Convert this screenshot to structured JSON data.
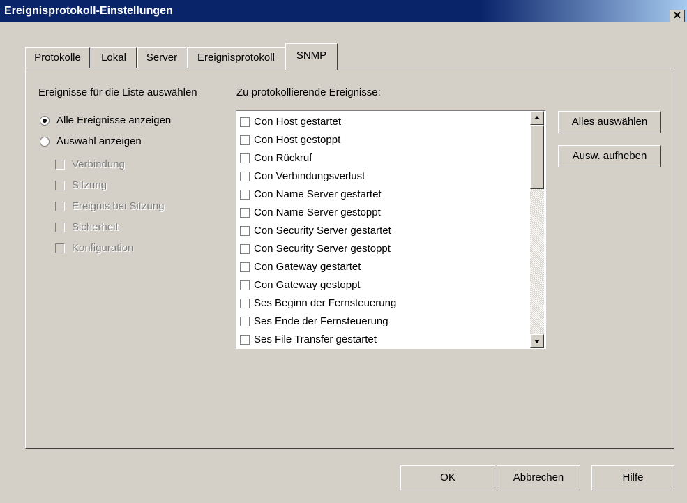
{
  "window": {
    "title": "Ereignisprotokoll-Einstellungen",
    "close_glyph": "✕"
  },
  "tabs": [
    "Protokolle",
    "Lokal",
    "Server",
    "Ereignisprotokoll",
    "SNMP"
  ],
  "left": {
    "heading": "Ereignisse für die Liste auswählen",
    "radio_all": "Alle Ereignisse anzeigen",
    "radio_selection": "Auswahl anzeigen",
    "categories": [
      "Verbindung",
      "Sitzung",
      "Ereignis bei Sitzung",
      "Sicherheit",
      "Konfiguration"
    ]
  },
  "events": {
    "heading": "Zu protokollierende Ereignisse:",
    "items": [
      "Con Host gestartet",
      "Con Host gestoppt",
      "Con Rückruf",
      "Con Verbindungsverlust",
      "Con Name Server gestartet",
      "Con Name Server gestoppt",
      "Con Security Server gestartet",
      "Con Security Server gestoppt",
      "Con Gateway gestartet",
      "Con Gateway gestoppt",
      "Ses Beginn der Fernsteuerung",
      "Ses Ende der Fernsteuerung",
      "Ses File Transfer gestartet"
    ]
  },
  "buttons": {
    "select_all": "Alles auswählen",
    "deselect": "Ausw. aufheben",
    "ok": "OK",
    "cancel": "Abbrechen",
    "help": "Hilfe"
  }
}
